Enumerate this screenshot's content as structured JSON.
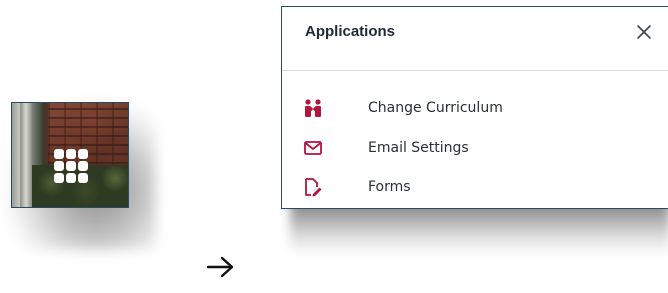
{
  "accent_color": "#b5123e",
  "border_color": "#2b4a66",
  "launcher": {
    "icon": "apps-grid-icon"
  },
  "arrow": {
    "icon": "arrow-right-icon",
    "glyph": "→"
  },
  "panel": {
    "title": "Applications",
    "close_icon": "close-icon",
    "close_glyph": "×",
    "items": [
      {
        "label": "Change Curriculum",
        "icon": "people-swap-icon"
      },
      {
        "label": "Email Settings",
        "icon": "envelope-icon"
      },
      {
        "label": "Forms",
        "icon": "form-edit-icon"
      }
    ]
  }
}
